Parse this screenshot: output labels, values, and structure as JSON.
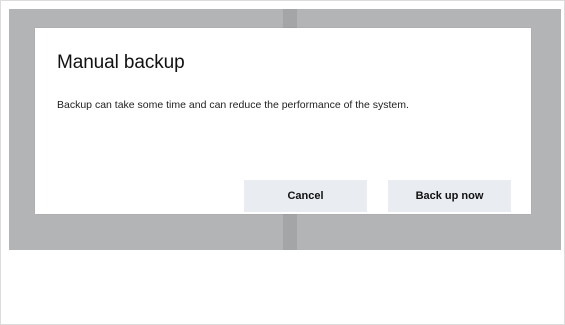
{
  "dialog": {
    "title": "Manual backup",
    "message": "Backup can take some time and can reduce the performance of the system.",
    "cancel_label": "Cancel",
    "confirm_label": "Back up now"
  },
  "colors": {
    "backdrop": "#b3b4b6",
    "dialog_background": "#ffffff",
    "button_background": "#e9edf1"
  }
}
